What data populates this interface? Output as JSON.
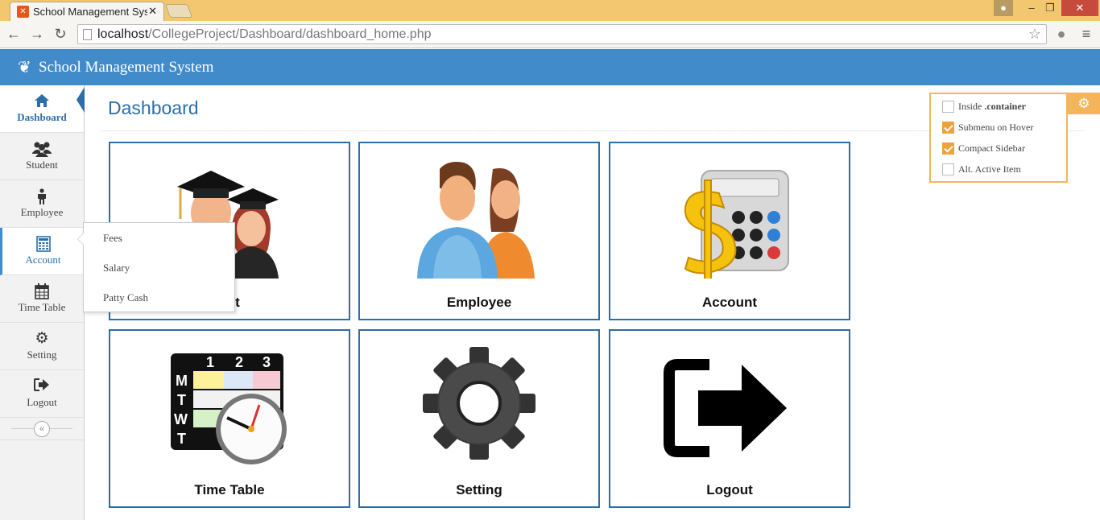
{
  "browser": {
    "tab_title": "School Management Syste",
    "tab_close": "✕",
    "url_host": "localhost",
    "url_path": "/CollegeProject/Dashboard/dashboard_home.php"
  },
  "header": {
    "title": "School Management System"
  },
  "sidebar": {
    "items": [
      {
        "label": "Dashboard",
        "icon": "home-icon"
      },
      {
        "label": "Student",
        "icon": "users-icon"
      },
      {
        "label": "Employee",
        "icon": "person-icon"
      },
      {
        "label": "Account",
        "icon": "calculator-icon"
      },
      {
        "label": "Time Table",
        "icon": "calendar-icon"
      },
      {
        "label": "Setting",
        "icon": "gear-icon"
      },
      {
        "label": "Logout",
        "icon": "sign-out-icon"
      }
    ],
    "active": "Dashboard",
    "hover": "Account"
  },
  "submenu": {
    "items": [
      "Fees",
      "Salary",
      "Patty Cash"
    ]
  },
  "main": {
    "page_title": "Dashboard",
    "cards": [
      {
        "label": "ent"
      },
      {
        "label": "Employee"
      },
      {
        "label": "Account"
      },
      {
        "label": "Time Table"
      },
      {
        "label": "Setting"
      },
      {
        "label": "Logout"
      }
    ]
  },
  "settings": {
    "options": [
      {
        "prefix": "Inside ",
        "bold": ".container",
        "checked": false
      },
      {
        "prefix": "Submenu on Hover",
        "bold": "",
        "checked": true
      },
      {
        "prefix": "Compact Sidebar",
        "bold": "",
        "checked": true
      },
      {
        "prefix": "Alt. Active Item",
        "bold": "",
        "checked": false
      }
    ]
  },
  "colors": {
    "header": "#428bca",
    "accent": "#2b6ea8",
    "settings": "#f4b55a"
  }
}
